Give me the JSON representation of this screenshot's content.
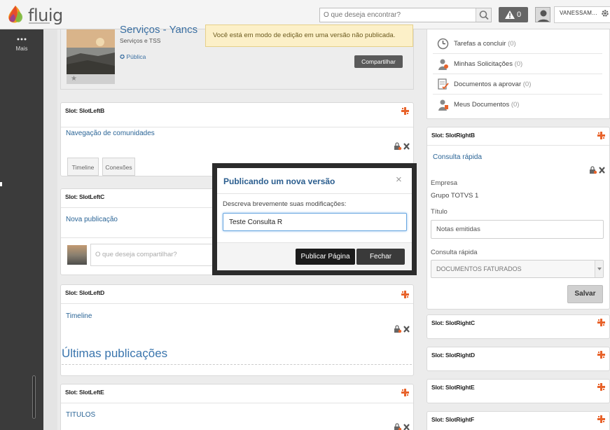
{
  "topbar": {
    "logo_text": "fluig",
    "search_placeholder": "O que deseja encontrar?",
    "alert_count": "0",
    "user_name": "VANESSAM..."
  },
  "sidebar": {
    "more_label": "Mais"
  },
  "community": {
    "title": "Serviços - Yancs",
    "subtitle": "Serviços e TSS",
    "visibility": "Pública",
    "share_label": "Compartilhar"
  },
  "notice": "Você está em modo de edição em uma versão não publicada.",
  "left_slots": {
    "b": {
      "title": "Slot: SlotLeftB",
      "link": "Navegação de comunidades",
      "tabs": [
        "Timeline",
        "Conexões"
      ]
    },
    "c": {
      "title": "Slot: SlotLeftC",
      "link": "Nova publicação",
      "post_placeholder": "O que deseja compartilhar?"
    },
    "d": {
      "title": "Slot: SlotLeftD",
      "link": "Timeline",
      "heading": "Últimas publicações"
    },
    "e": {
      "title": "Slot: SlotLeftE",
      "link": "TITULOS"
    }
  },
  "tasks": [
    {
      "label": "Tarefas a concluir",
      "count": "(0)",
      "icon": "clock-icon"
    },
    {
      "label": "Minhas Solicitações",
      "count": "(0)",
      "icon": "user-request-icon"
    },
    {
      "label": "Documentos a aprovar",
      "count": "(0)",
      "icon": "document-approve-icon"
    },
    {
      "label": "Meus Documentos",
      "count": "(0)",
      "icon": "user-document-icon"
    }
  ],
  "right_slots": {
    "b": {
      "title": "Slot: SlotRightB",
      "link": "Consulta rápida",
      "empresa_label": "Empresa",
      "empresa_value": "Grupo TOTVS 1",
      "titulo_label": "Título",
      "titulo_value": "Notas emitidas",
      "consulta_label": "Consulta rápida",
      "consulta_value": "DOCUMENTOS FATURADOS",
      "save_label": "Salvar"
    },
    "c": {
      "title": "Slot: SlotRightC"
    },
    "d": {
      "title": "Slot: SlotRightD"
    },
    "e": {
      "title": "Slot: SlotRightE"
    },
    "f": {
      "title": "Slot: SlotRightF"
    }
  },
  "modal": {
    "title": "Publicando um nova versão",
    "close_glyph": "×",
    "description": "Descreva brevemente suas modificações:",
    "input_value": "Teste Consulta R",
    "publish_label": "Publicar Página",
    "close_label": "Fechar"
  },
  "colors": {
    "accent": "#2a6496",
    "notice_bg": "#fcf0c8",
    "sidebar": "#3b3b3b",
    "plus_icon": "#e8632b"
  }
}
